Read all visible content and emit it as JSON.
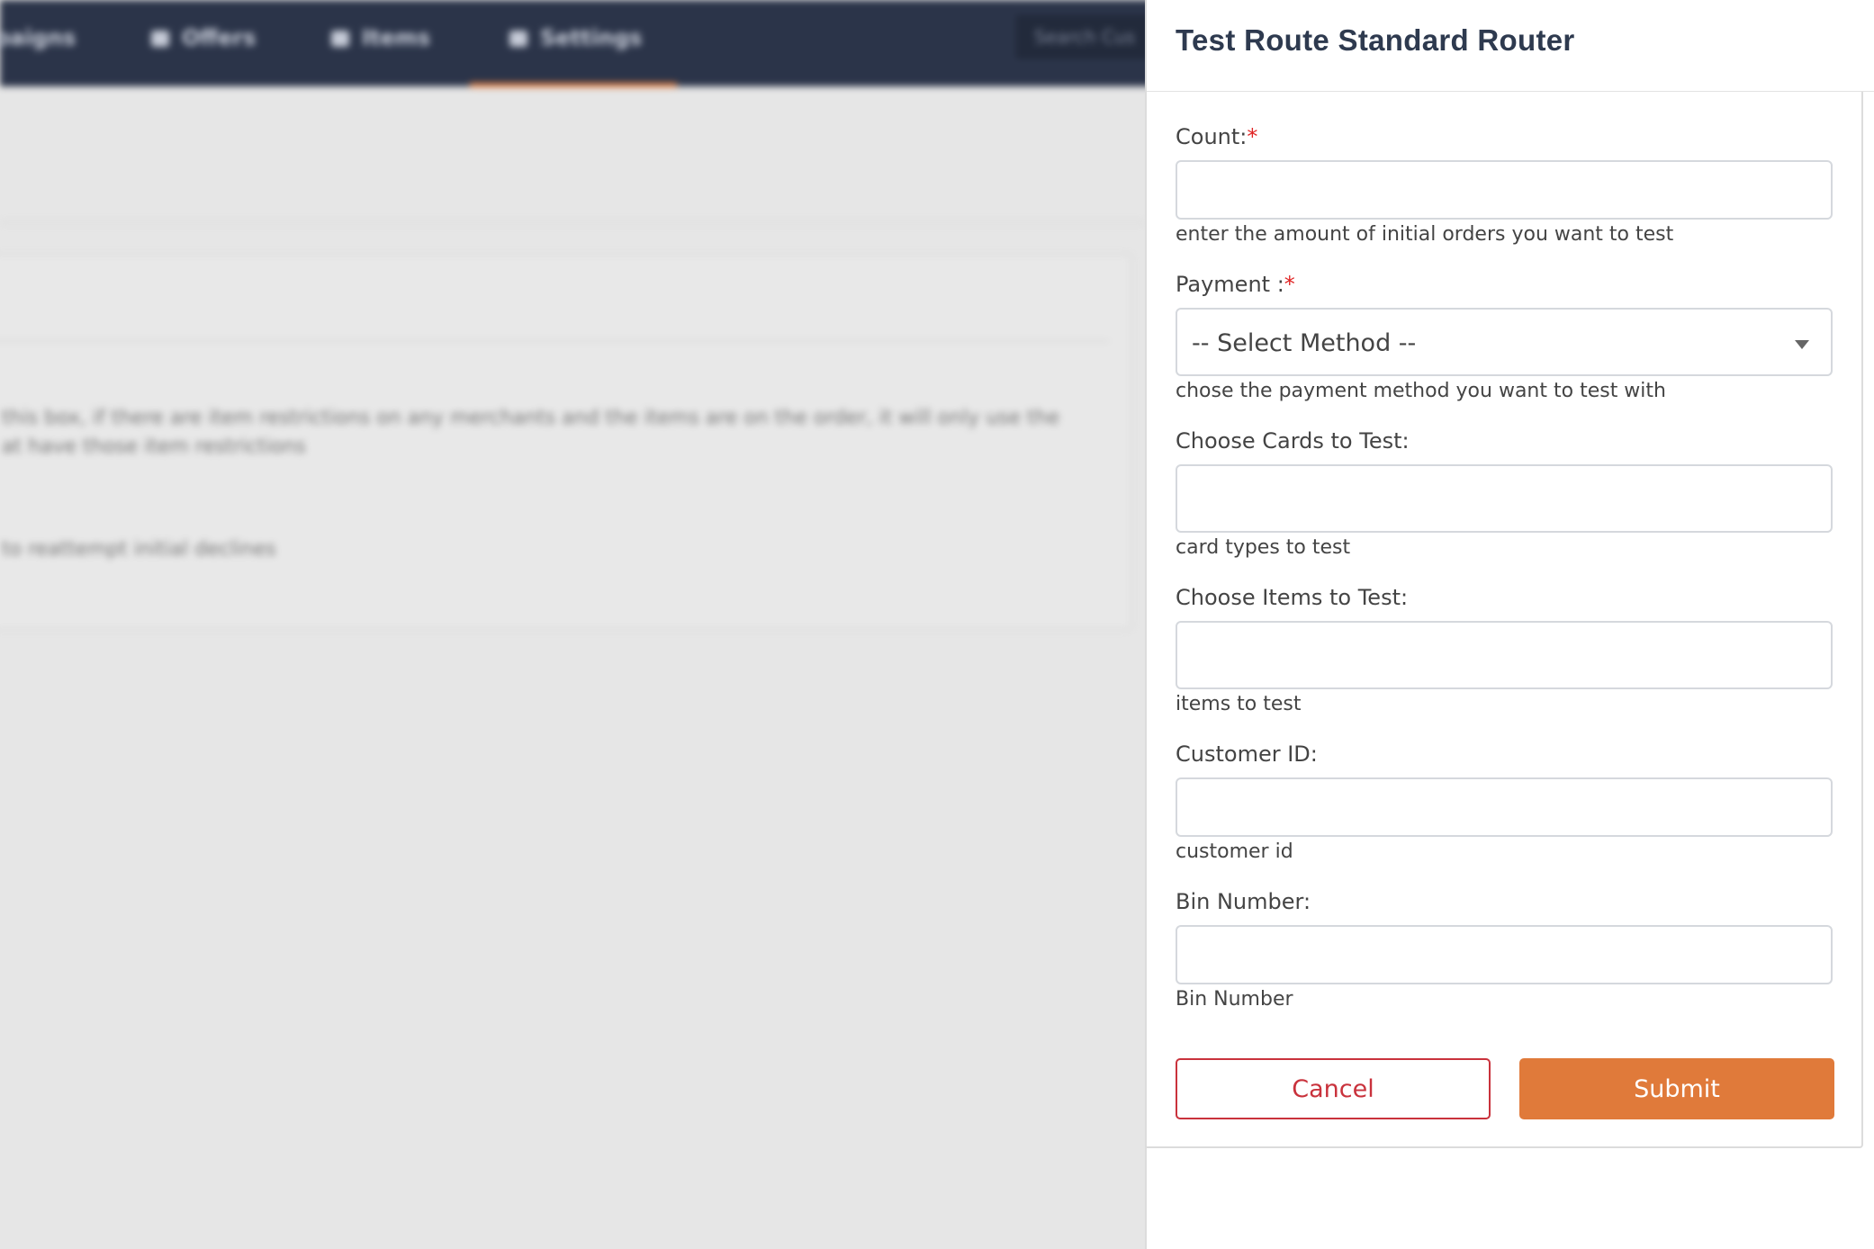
{
  "background": {
    "nav_items": [
      {
        "label": "paigns"
      },
      {
        "label": "Offers"
      },
      {
        "label": "Items"
      },
      {
        "label": "Settings"
      }
    ],
    "search_placeholder": "Search Cus",
    "card_text_line1": "this box, if there are item restrictions on any merchants and the items are on the order, it will only use the",
    "card_text_line2": "at have those item restrictions",
    "card_text_line3": "to reattempt initial declines"
  },
  "panel": {
    "title": "Test Route Standard Router",
    "fields": {
      "count": {
        "label": "Count:",
        "required_mark": "*",
        "value": "",
        "help": "enter the amount of initial orders you want to test"
      },
      "payment": {
        "label": "Payment :",
        "required_mark": "*",
        "selected": "-- Select Method --",
        "help": "chose the payment method you want to test with"
      },
      "cards": {
        "label": "Choose Cards to Test:",
        "value": "",
        "help": "card types to test"
      },
      "items": {
        "label": "Choose Items to Test:",
        "value": "",
        "help": "items to test"
      },
      "customer_id": {
        "label": "Customer ID:",
        "value": "",
        "help": "customer id"
      },
      "bin_number": {
        "label": "Bin Number:",
        "value": "",
        "help": "Bin Number"
      }
    },
    "buttons": {
      "cancel": "Cancel",
      "submit": "Submit"
    }
  },
  "colors": {
    "nav_bg": "#2b3449",
    "accent": "#e07a3a",
    "cancel": "#c9323c",
    "required": "#e02424"
  }
}
